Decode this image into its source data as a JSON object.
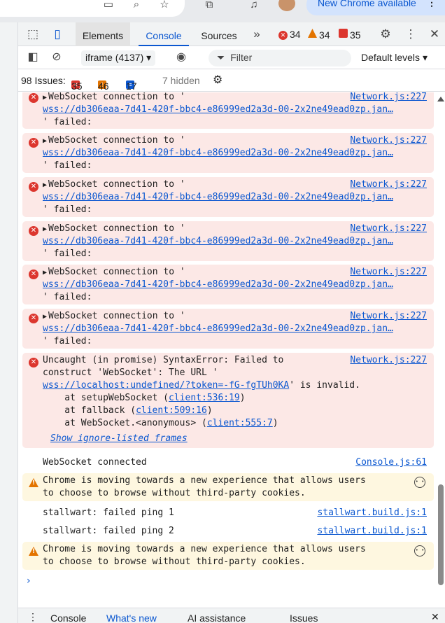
{
  "browser": {
    "new_chrome_label": "New Chrome available",
    "menu_icon": "kebab-icon"
  },
  "devtools": {
    "tabs": [
      {
        "label": "Elements"
      },
      {
        "label": "Console"
      },
      {
        "label": "Sources"
      }
    ],
    "more_tabs": "»",
    "counters": {
      "errors": "34",
      "warnings": "34",
      "messages": "35"
    },
    "toolbar": {
      "context": "iframe (4137)",
      "filter_placeholder": "Filter",
      "levels": "Default levels"
    },
    "issues": {
      "label": "98 Issues:",
      "errors": "35",
      "warnings": "46",
      "info": "17",
      "hidden": "7 hidden"
    },
    "log": {
      "ws_fail_line1": "WebSocket connection to '",
      "ws_fail_url": "wss://db306eaa-7d41-420f-bbc4-e86999ed2a3d-00-2x2ne49ead0zp.jan…",
      "ws_fail_line3": "' failed:",
      "ws_source": "Network.js:227",
      "uncaught": {
        "line1": "Uncaught (in promise) SyntaxError: Failed to",
        "line2": "construct 'WebSocket': The URL '",
        "url": "wss://localhost:undefined/?token=-fG-fgTUh0KA",
        "line3_tail": "' is invalid.",
        "stack1_pre": "    at setupWebSocket (",
        "stack1_link": "client:536:19",
        "stack2_pre": "    at fallback (",
        "stack2_link": "client:509:16",
        "stack3_pre": "    at WebSocket.<anonymous> (",
        "stack3_link": "client:555:7",
        "close": ")",
        "show_frames": "Show ignore-listed frames",
        "source": "Network.js:227"
      },
      "connected": {
        "text": "WebSocket connected",
        "source": "Console.js:61"
      },
      "cookie_warning": {
        "line1": "Chrome is moving towards a new experience that allows users",
        "line2": "to choose to browse without third-party cookies."
      },
      "ping1": {
        "text": "stallwart: failed ping 1",
        "source": "stallwart.build.js:1"
      },
      "ping2": {
        "text": "stallwart: failed ping 2",
        "source": "stallwart.build.js:1"
      },
      "prompt": "›"
    },
    "drawer": {
      "tabs": [
        "Console",
        "What's new",
        "AI assistance",
        "Issues"
      ]
    }
  }
}
